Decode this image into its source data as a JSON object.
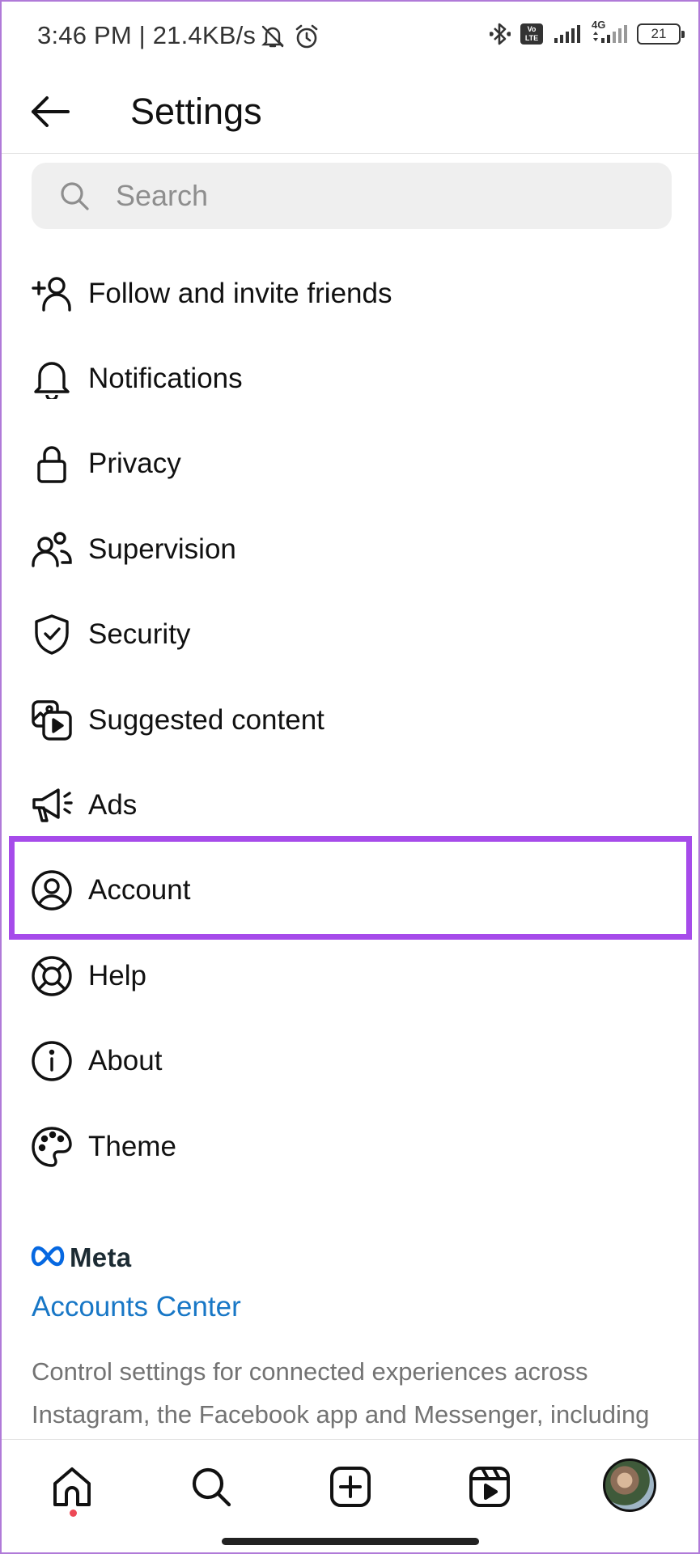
{
  "status_bar": {
    "time": "3:46 PM | 21.4KB/s",
    "battery": "21",
    "network": "4G",
    "volte": "Vo LTE",
    "icons": [
      "mute-icon",
      "alarm-icon",
      "bluetooth-icon",
      "volte-icon",
      "signal-icon",
      "signal-4g-icon",
      "battery-icon"
    ]
  },
  "header": {
    "back_icon": "arrow-left-icon",
    "title": "Settings"
  },
  "search": {
    "icon": "search-icon",
    "placeholder": "Search"
  },
  "menu": {
    "items": [
      {
        "label": "Follow and invite friends",
        "icon": "add-person-icon"
      },
      {
        "label": "Notifications",
        "icon": "bell-icon"
      },
      {
        "label": "Privacy",
        "icon": "lock-icon"
      },
      {
        "label": "Supervision",
        "icon": "supervision-icon"
      },
      {
        "label": "Security",
        "icon": "shield-check-icon"
      },
      {
        "label": "Suggested content",
        "icon": "media-play-icon"
      },
      {
        "label": "Ads",
        "icon": "megaphone-icon"
      },
      {
        "label": "Account",
        "icon": "user-circle-icon",
        "highlighted": true
      },
      {
        "label": "Help",
        "icon": "lifebuoy-icon"
      },
      {
        "label": "About",
        "icon": "info-icon"
      },
      {
        "label": "Theme",
        "icon": "palette-icon"
      }
    ],
    "highlight_color": "#a64bea"
  },
  "meta": {
    "logo_text": "Meta",
    "accounts_center": "Accounts Center",
    "description": "Control settings for connected experiences across Instagram, the Facebook app and Messenger, including"
  },
  "bottom_nav": {
    "items": [
      "home-icon",
      "search-icon",
      "create-icon",
      "reels-icon",
      "profile-avatar"
    ],
    "notification_dot_color": "#ed4956"
  }
}
